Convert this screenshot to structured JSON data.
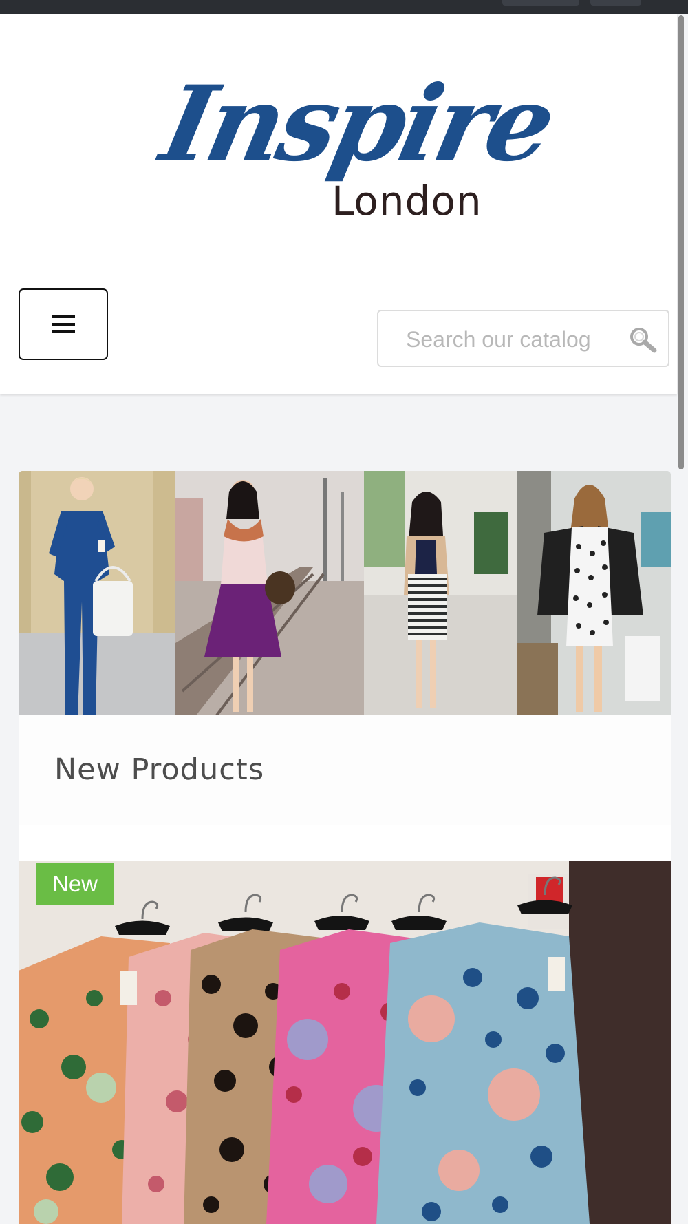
{
  "brand": {
    "logo_script": "Inspire",
    "logo_city": "London",
    "colors": {
      "script": "#1d4f8c",
      "city": "#2d1f1f"
    }
  },
  "header": {
    "menu_icon": "hamburger-icon",
    "search": {
      "placeholder": "Search our catalog",
      "value": "",
      "icon": "search-icon"
    }
  },
  "hero": {
    "panels": [
      {
        "name": "hero-panel-blue-jumpsuit"
      },
      {
        "name": "hero-panel-purple-skirt"
      },
      {
        "name": "hero-panel-striped-skirt"
      },
      {
        "name": "hero-panel-print-dress"
      }
    ]
  },
  "new_products": {
    "title": "New Products",
    "items": [
      {
        "badge": "New",
        "badge_color": "#6abd45"
      }
    ]
  }
}
